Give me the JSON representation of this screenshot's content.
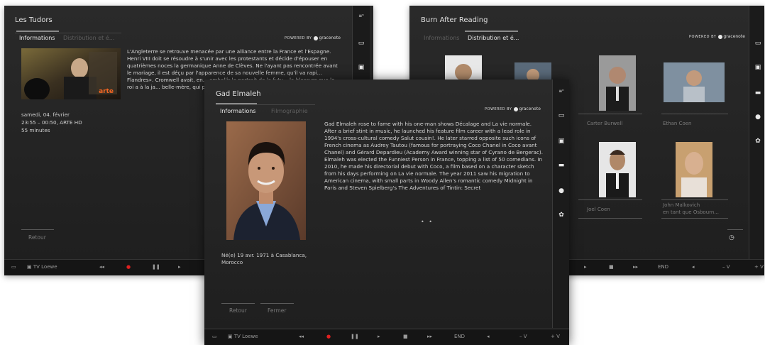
{
  "left_window": {
    "title": "Les Tudors",
    "tabs": [
      "Informations",
      "Distribution et é..."
    ],
    "powered_prefix": "POWERED BY",
    "powered_brand": "gracenote",
    "channel_logo": "arte",
    "paragraph": "L'Angleterre se retrouve menacée par une alliance entre la France et l'Espagne. Henri VIII doit se résoudre à s'unir avec les protestants et décide d'épouser en quatrièmes noces la germanique Anne de Clèves. Ne l'ayant pas rencontrée avant le mariage, il est déçu par l'apparence de sa nouvelle femme, qu'il va rapi... Flandres». Cromwell avait, en... embellir le portrait de la futu... la blessure que le roi a à la ja... belle-mère, qui pourtant la p...",
    "date": "samedi, 04. février",
    "time": "23:55 – 00:50, ARTE HD",
    "duration": "55 minutes",
    "back": "Retour",
    "bottombar": {
      "tv": "TV Loewe"
    }
  },
  "right_window": {
    "title": "Burn After Reading",
    "tabs": [
      "Informations",
      "Distribution et é..."
    ],
    "powered_prefix": "POWERED BY",
    "powered_brand": "gracenote",
    "cast": [
      {
        "name": "Carter Burwell",
        "role": ""
      },
      {
        "name": "Ethan Coen",
        "role": ""
      },
      {
        "name": "Joel Coen",
        "role": ""
      },
      {
        "name": "John Malkovich",
        "role": "en tant que Osbourn..."
      }
    ],
    "bottombar": {
      "end": "END",
      "vol_down": "– V",
      "vol_up": "+ V"
    }
  },
  "center_window": {
    "title": "Gad Elmaleh",
    "tabs": [
      "Informations",
      "Filmographie"
    ],
    "powered_prefix": "POWERED BY",
    "powered_brand": "gracenote",
    "biography": "Gad Elmaleh rose to fame with his one-man shows Décalage and La vie normale. After a brief stint in music, he launched his feature film career with a lead role in 1994's cross-cultural comedy Salut cousin!. He later starred opposite such icons of French cinema as Audrey Tautou (famous for portraying Coco Chanel in Coco avant Chanel) and Gérard Depardieu (Academy Award winning star of Cyrano de Bergerac). Elmaleh was elected the Funniest Person in France, topping a list of 50 comedians. In 2010, he made his directorial debut with Coco, a film based on a character sketch from his days performing on La vie normale. The year 2011 saw his migration to American cinema, with small parts in Woody Allen's romantic comedy Midnight in Paris and Steven Spielberg's The Adventures of Tintin: Secret",
    "birth": "Né(e) 19 avr. 1971 à Casablanca, Morocco",
    "buttons": {
      "back": "Retour",
      "close": "Fermer"
    },
    "pager": "• •",
    "bottombar": {
      "tv": "TV Loewe",
      "end": "END",
      "vol_down": "– V",
      "vol_up": "+ V"
    }
  },
  "colors": {
    "background": "#262626",
    "accent_red": "#e02020",
    "text": "#d6d6d6",
    "dim_text": "#7a7a7a"
  }
}
